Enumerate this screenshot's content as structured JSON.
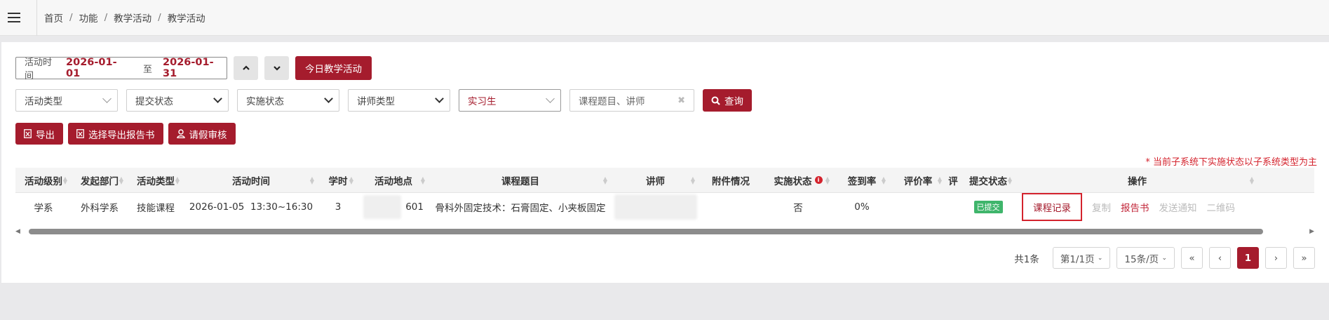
{
  "breadcrumb": [
    "首页",
    "功能",
    "教学活动",
    "教学活动"
  ],
  "date_filter": {
    "label": "活动时间",
    "start": "2026-01-01",
    "to": "至",
    "end": "2026-01-31"
  },
  "today_button": "今日教学活动",
  "filters": {
    "activity_type": "活动类型",
    "submit_status": "提交状态",
    "impl_status": "实施状态",
    "lecturer_type": "讲师类型",
    "student_type": "实习生",
    "search_placeholder": "课程题目、讲师",
    "query_button": "查询"
  },
  "actions": {
    "export": "导出",
    "export_report": "选择导出报告书",
    "leave_review": "请假审核"
  },
  "note": "* 当前子系统下实施状态以子系统类型为主",
  "columns": [
    "活动级别",
    "发起部门",
    "活动类型",
    "活动时间",
    "学时",
    "活动地点",
    "课程题目",
    "讲师",
    "附件情况",
    "实施状态",
    "签到率",
    "评价率",
    "评",
    "提交状态",
    "操作"
  ],
  "rows": [
    {
      "level": "学系",
      "dept": "外科学系",
      "type": "技能课程",
      "time": "2026-01-05  13:30~16:30",
      "hours": "3",
      "location": "601",
      "title": "骨科外固定技术：石膏固定、小夹板固定",
      "lecturer": "",
      "attachment": "",
      "impl_status": "否",
      "sign_rate": "0%",
      "eval_rate": "",
      "submit_status": "已提交",
      "ops": [
        "课程记录",
        "复制",
        "报告书",
        "发送通知",
        "二维码"
      ]
    }
  ],
  "pagination": {
    "total": "共1条",
    "page_select": "第1/1页",
    "size_select": "15条/页",
    "first": "«",
    "prev": "‹",
    "current": "1",
    "next": "›",
    "last": "»"
  },
  "colors": {
    "brand": "#a51c2d",
    "note": "#d4232d",
    "badge": "#3fb56b"
  }
}
